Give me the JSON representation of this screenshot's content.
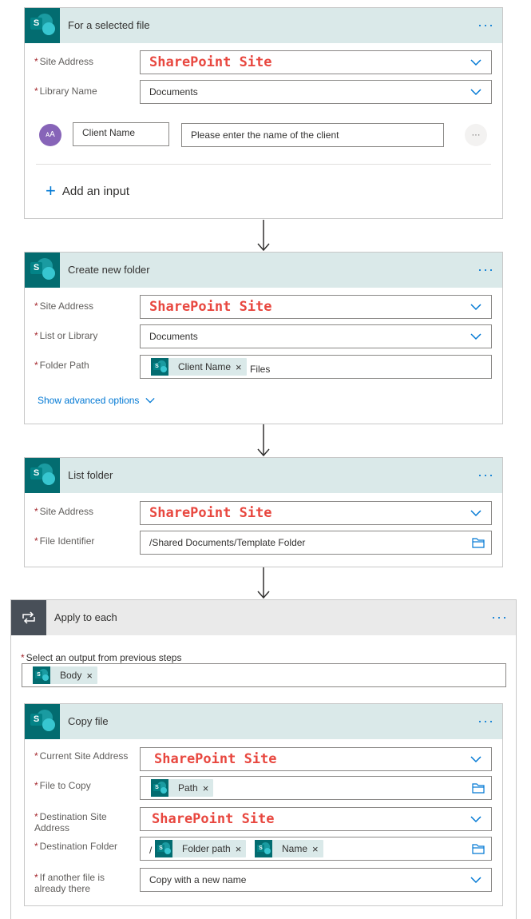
{
  "card1": {
    "title": "For a selected file",
    "site_label": "Site Address",
    "site_value": "SharePoint Site",
    "library_label": "Library Name",
    "library_value": "Documents",
    "input_avatar": "ᴀA",
    "input_name": "Client Name",
    "input_description": "Please enter the name of the client",
    "input_more": "···",
    "add_input": "Add an input"
  },
  "card2": {
    "title": "Create new folder",
    "site_label": "Site Address",
    "site_value": "SharePoint Site",
    "list_label": "List or Library",
    "list_value": "Documents",
    "folder_label": "Folder Path",
    "folder_token": "Client Name",
    "folder_suffix": "Files",
    "advanced": "Show advanced options"
  },
  "card3": {
    "title": "List folder",
    "site_label": "Site Address",
    "site_value": "SharePoint Site",
    "file_label": "File Identifier",
    "file_value": "/Shared Documents/Template Folder"
  },
  "apply": {
    "title": "Apply to each",
    "select_label": "Select an output from previous steps",
    "token": "Body"
  },
  "copy": {
    "title": "Copy file",
    "current_label": "Current Site Address",
    "current_value": "SharePoint Site",
    "file_label": "File to Copy",
    "file_token": "Path",
    "dest_site_label_1": "Destination Site",
    "dest_site_label_2": "Address",
    "dest_site_value": "SharePoint Site",
    "dest_folder_label": "Destination Folder",
    "dest_folder_prefix": "/",
    "dest_folder_token1": "Folder path",
    "dest_folder_token2": "Name",
    "another_label_1": "If another file is",
    "another_label_2": "already there",
    "another_value": "Copy with a new name"
  },
  "ui": {
    "dots": "···",
    "required": "*",
    "remove": "×",
    "sp_letter": "S",
    "plus": "+"
  },
  "colors": {
    "header_bg": "#dae9e9",
    "sharepoint": "#036c70",
    "accent": "#0078d4",
    "annotation_red": "#e8473f"
  }
}
